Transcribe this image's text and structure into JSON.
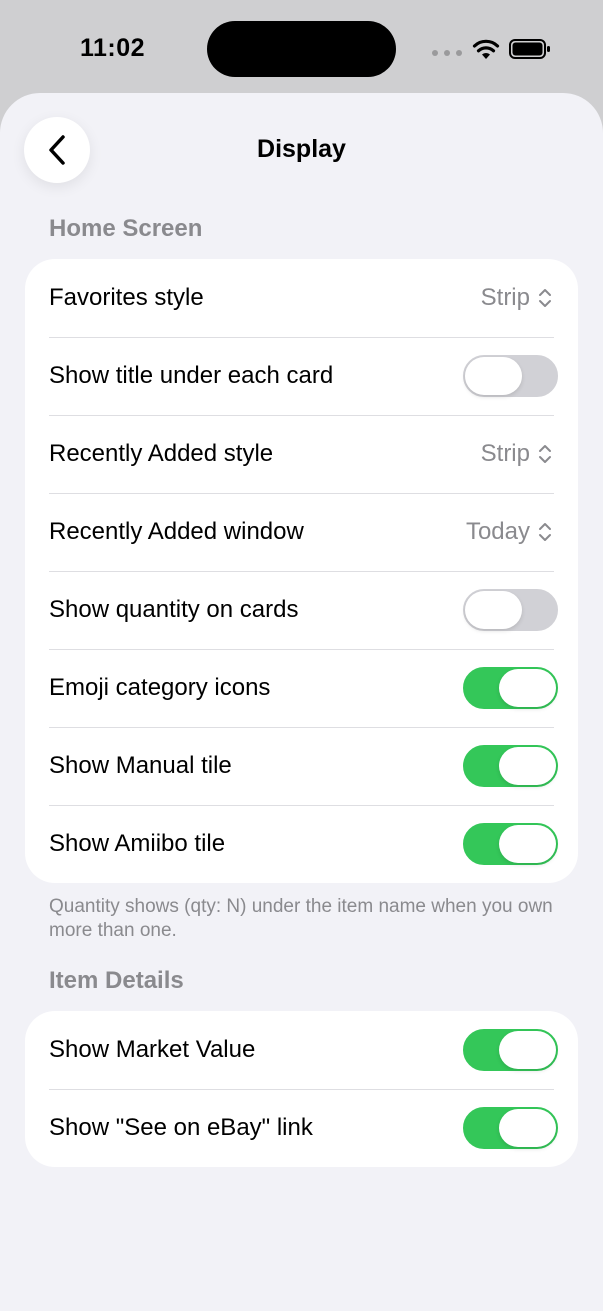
{
  "status": {
    "time": "11:02"
  },
  "nav": {
    "title": "Display"
  },
  "home_screen": {
    "header": "Home Screen",
    "rows": [
      {
        "label": "Favorites style",
        "kind": "picker",
        "value": "Strip"
      },
      {
        "label": "Show title under each card",
        "kind": "toggle",
        "on": false
      },
      {
        "label": "Recently Added style",
        "kind": "picker",
        "value": "Strip"
      },
      {
        "label": "Recently Added window",
        "kind": "picker",
        "value": "Today"
      },
      {
        "label": "Show quantity on cards",
        "kind": "toggle",
        "on": false
      },
      {
        "label": "Emoji category icons",
        "kind": "toggle",
        "on": true
      },
      {
        "label": "Show Manual tile",
        "kind": "toggle",
        "on": true
      },
      {
        "label": "Show Amiibo tile",
        "kind": "toggle",
        "on": true
      }
    ],
    "footer": "Quantity shows (qty: N) under the item name when you own more than one."
  },
  "item_details": {
    "header": "Item Details",
    "rows": [
      {
        "label": "Show Market Value",
        "kind": "toggle",
        "on": true
      },
      {
        "label": "Show \"See on eBay\" link",
        "kind": "toggle",
        "on": true
      }
    ]
  },
  "colors": {
    "toggle_on": "#34c759",
    "toggle_off": "#d1d1d6",
    "secondary_text": "#8a8a8e"
  }
}
